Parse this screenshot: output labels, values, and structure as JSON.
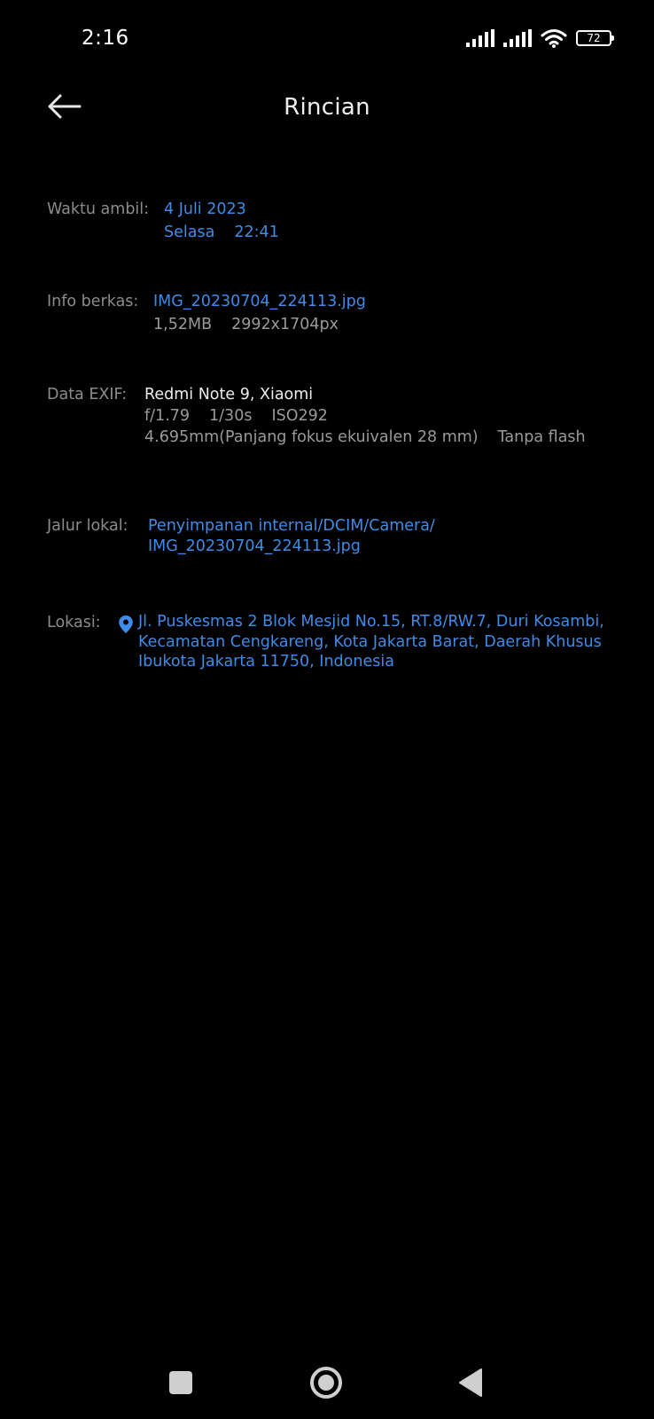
{
  "status_bar": {
    "time": "2:16",
    "battery_level": "72"
  },
  "app_bar": {
    "title": "Rincian",
    "back_icon": "arrow-left-icon"
  },
  "details": {
    "capture_time": {
      "label": "Waktu ambil:",
      "date": "4 Juli 2023",
      "day": "Selasa",
      "time": "22:41"
    },
    "file_info": {
      "label": "Info berkas:",
      "filename": "IMG_20230704_224113.jpg",
      "size": "1,52MB",
      "resolution": "2992x1704px"
    },
    "exif": {
      "label": "Data EXIF:",
      "device": "Redmi Note 9, Xiaomi",
      "aperture": "f/1.79",
      "shutter": "1/30s",
      "iso": "ISO292",
      "focal": "4.695mm(Panjang fokus ekuivalen 28 mm)",
      "flash": "Tanpa flash"
    },
    "local_path": {
      "label": "Jalur lokal:",
      "line1": "Penyimpanan internal/DCIM/Camera/",
      "line2": "IMG_20230704_224113.jpg"
    },
    "location": {
      "label": "Lokasi:",
      "icon": "location-pin-icon",
      "address": "Jl. Puskesmas 2 Blok Mesjid No.15, RT.8/RW.7, Duri Kosambi, Kecamatan Cengkareng, Kota Jakarta Barat, Daerah Khusus Ibukota Jakarta 11750, Indonesia"
    }
  },
  "colors": {
    "background": "#000000",
    "accent": "#3f8be6",
    "label": "#8c8c8c"
  }
}
